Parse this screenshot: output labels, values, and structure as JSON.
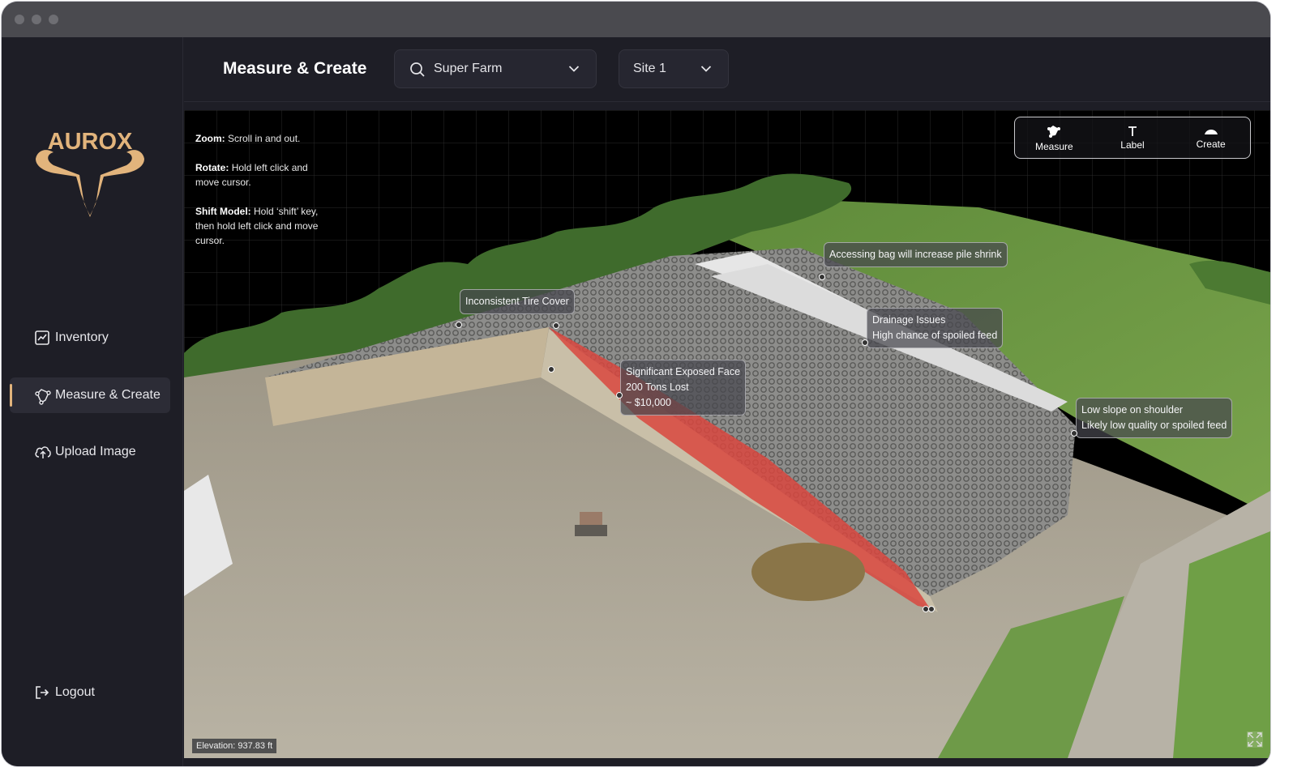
{
  "sidebar": {
    "logo_text": "AUROX",
    "items": [
      {
        "label": "Inventory",
        "icon": "chart-icon"
      },
      {
        "label": "Measure & Create",
        "icon": "measure-icon",
        "active": true
      },
      {
        "label": "Upload Image",
        "icon": "cloud-upload-icon"
      }
    ],
    "logout_label": "Logout"
  },
  "header": {
    "title": "Measure & Create",
    "farm_select": {
      "value": "Super Farm"
    },
    "site_select": {
      "value": "Site 1"
    }
  },
  "help": {
    "zoom_key": "Zoom:",
    "zoom_text": "Scroll in and out.",
    "rotate_key": "Rotate:",
    "rotate_text": "Hold left click and move cursor.",
    "shift_key": "Shift Model:",
    "shift_text": "Hold ‘shift’ key, then hold left click and move cursor."
  },
  "toolbar": {
    "measure_label": "Measure",
    "label_label": "Label",
    "create_label": "Create"
  },
  "annotations": {
    "tire_cover": {
      "line1": "Inconsistent Tire Cover"
    },
    "bag": {
      "line1": "Accessing bag will increase pile shrink"
    },
    "drainage": {
      "line1": "Drainage Issues",
      "line2": "High chance of spoiled feed"
    },
    "exposed": {
      "line1": "Significant Exposed Face",
      "line2": "200 Tons Lost",
      "line3": "~ $10,000"
    },
    "slope": {
      "line1": "Low slope on shoulder",
      "line2": "Likely low quality or spoiled feed"
    }
  },
  "status": {
    "elevation": "Elevation: 937.83 ft"
  },
  "colors": {
    "accent": "#e2b47c",
    "background": "#1e1e26",
    "highlight": "#d9463e"
  }
}
